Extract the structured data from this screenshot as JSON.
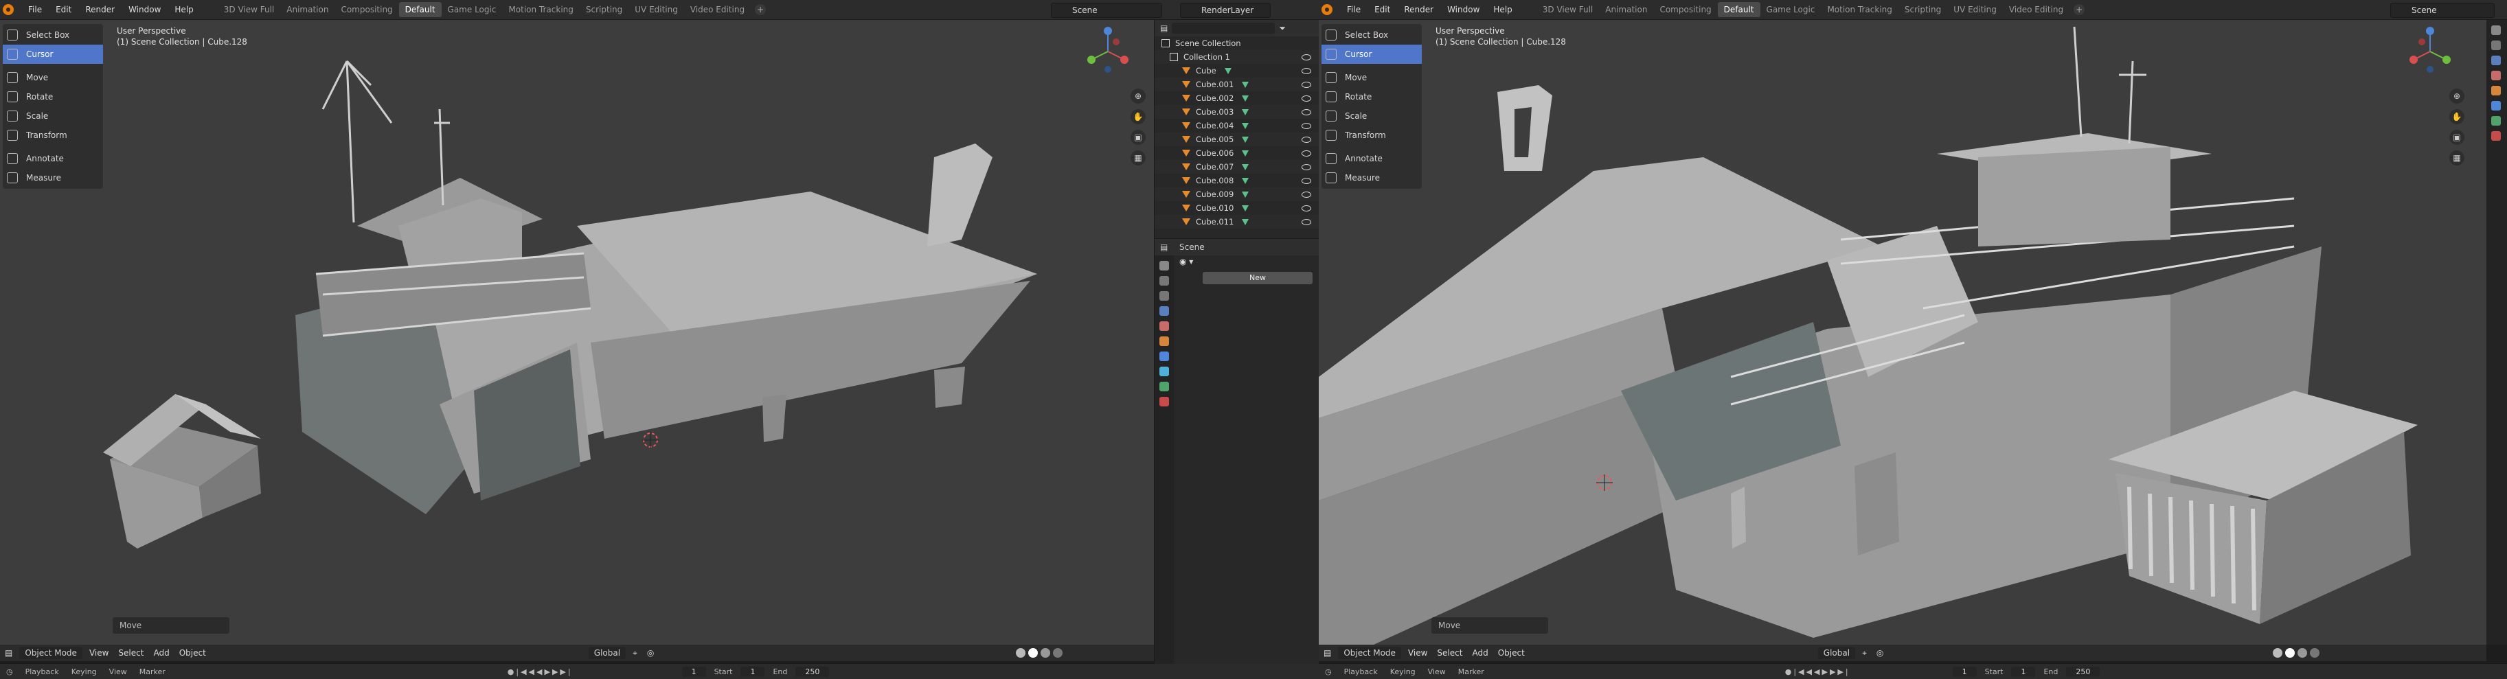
{
  "menu": [
    "File",
    "Edit",
    "Render",
    "Window",
    "Help"
  ],
  "workspace_tabs": [
    {
      "label": "3D View Full",
      "active": false
    },
    {
      "label": "Animation",
      "active": false
    },
    {
      "label": "Compositing",
      "active": false
    },
    {
      "label": "Default",
      "active": true
    },
    {
      "label": "Game Logic",
      "active": false
    },
    {
      "label": "Motion Tracking",
      "active": false
    },
    {
      "label": "Scripting",
      "active": false
    },
    {
      "label": "UV Editing",
      "active": false
    },
    {
      "label": "Video Editing",
      "active": false
    }
  ],
  "scene_name": "Scene",
  "render_layer": "RenderLayer",
  "tools": [
    "Select Box",
    "Cursor",
    "Move",
    "Rotate",
    "Scale",
    "Transform",
    "Annotate",
    "Measure"
  ],
  "active_tool": "Cursor",
  "viewport": {
    "perspective": "User Perspective",
    "context": "(1) Scene Collection | Cube.128",
    "last_operator": "Move"
  },
  "viewport_header": {
    "mode": "Object Mode",
    "menus": [
      "View",
      "Select",
      "Add",
      "Object"
    ],
    "orientation": "Global"
  },
  "timeline": {
    "menus": [
      "Playback",
      "Keying",
      "View",
      "Marker"
    ],
    "current_frame": "1",
    "start_label": "Start",
    "start": "1",
    "end_label": "End",
    "end": "250"
  },
  "outliner": {
    "root": "Scene Collection",
    "collection": "Collection 1",
    "objects": [
      "Cube",
      "Cube.001",
      "Cube.002",
      "Cube.003",
      "Cube.004",
      "Cube.005",
      "Cube.006",
      "Cube.007",
      "Cube.008",
      "Cube.009",
      "Cube.010",
      "Cube.011"
    ]
  },
  "properties": {
    "scene_label": "Scene",
    "new_button": "New"
  }
}
